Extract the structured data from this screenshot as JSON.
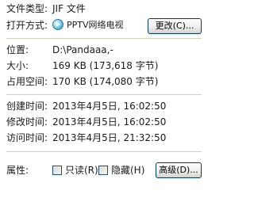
{
  "file_type": {
    "label": "文件类型:",
    "value": "JIF 文件"
  },
  "open_with": {
    "label": "打开方式:",
    "app_name": "PPTV网络电视",
    "app_icon": "pptv-icon",
    "change_button": "更改(C)..."
  },
  "location": {
    "label": "位置:",
    "value": "D:\\Pandaaa,-"
  },
  "size": {
    "label": "大小:",
    "value": "169 KB (173,618 字节)"
  },
  "size_on_disk": {
    "label": "占用空间:",
    "value": "170 KB (174,080 字节)"
  },
  "created": {
    "label": "创建时间:",
    "value": "2013年4月5日, 16:02:50"
  },
  "modified": {
    "label": "修改时间:",
    "value": "2013年4月5日, 16:02:50"
  },
  "accessed": {
    "label": "访问时间:",
    "value": "2013年4月5日, 21:32:50"
  },
  "attributes": {
    "label": "属性:",
    "readonly_label": "只读(R)",
    "hidden_label": "隐藏(H)",
    "advanced_button": "高级(D)..."
  }
}
